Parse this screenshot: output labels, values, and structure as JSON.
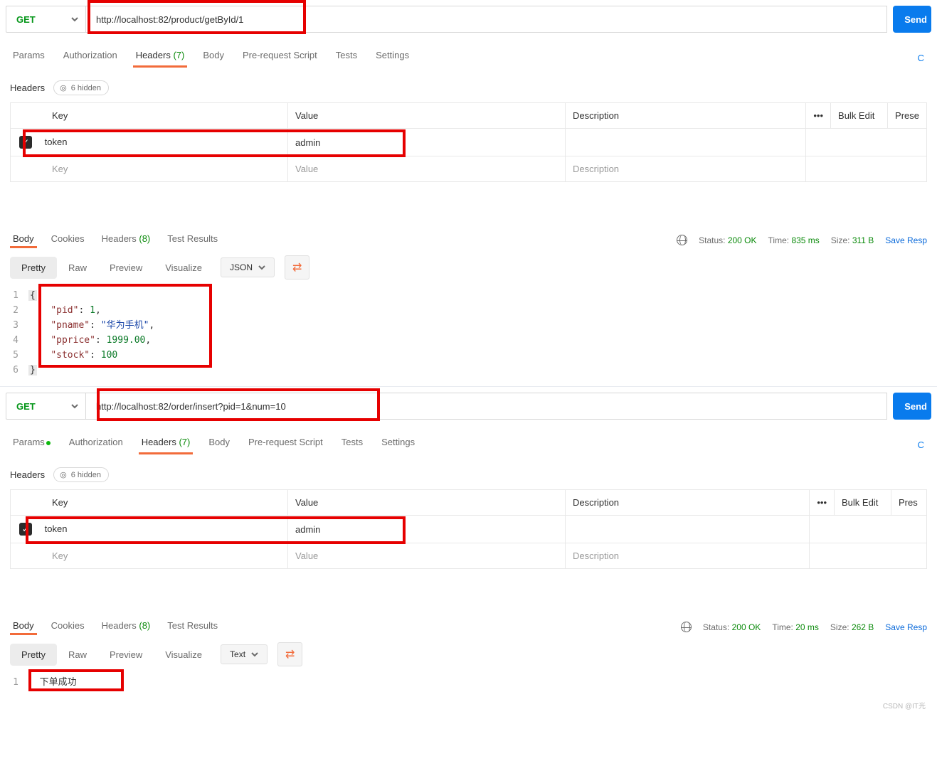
{
  "watermark": "CSDN @IT光",
  "req1": {
    "method": "GET",
    "url": "http://localhost:82/product/getById/1",
    "send": "Send",
    "tabs": {
      "params": "Params",
      "auth": "Authorization",
      "headers": "Headers",
      "headers_count": "(7)",
      "body": "Body",
      "prereq": "Pre-request Script",
      "tests": "Tests",
      "settings": "Settings",
      "cookies": "C"
    },
    "section": {
      "title": "Headers",
      "hidden": "6 hidden"
    },
    "table": {
      "key": "Key",
      "value": "Value",
      "desc": "Description",
      "bulk": "Bulk Edit",
      "presets": "Prese",
      "row1_key": "token",
      "row1_val": "admin",
      "ph_key": "Key",
      "ph_val": "Value",
      "ph_desc": "Description"
    },
    "resp_tabs": {
      "body": "Body",
      "cookies": "Cookies",
      "headers": "Headers",
      "hcount": "(8)",
      "test": "Test Results"
    },
    "status": {
      "status_l": "Status:",
      "status_v": "200 OK",
      "time_l": "Time:",
      "time_v": "835 ms",
      "size_l": "Size:",
      "size_v": "311 B",
      "save": "Save Resp"
    },
    "view": {
      "pretty": "Pretty",
      "raw": "Raw",
      "preview": "Preview",
      "vis": "Visualize",
      "fmt": "JSON"
    },
    "json": {
      "l1": "{",
      "l6": "}",
      "k_pid": "\"pid\"",
      "v_pid": "1",
      "k_pname": "\"pname\"",
      "v_pname": "\"华为手机\"",
      "k_pprice": "\"pprice\"",
      "v_pprice": "1999.00",
      "k_stock": "\"stock\"",
      "v_stock": "100"
    }
  },
  "req2": {
    "method": "GET",
    "url": "http://localhost:82/order/insert?pid=1&num=10",
    "send": "Send",
    "tabs": {
      "params": "Params",
      "auth": "Authorization",
      "headers": "Headers",
      "headers_count": "(7)",
      "body": "Body",
      "prereq": "Pre-request Script",
      "tests": "Tests",
      "settings": "Settings",
      "cookies": "C"
    },
    "section": {
      "title": "Headers",
      "hidden": "6 hidden"
    },
    "table": {
      "key": "Key",
      "value": "Value",
      "desc": "Description",
      "bulk": "Bulk Edit",
      "presets": "Pres",
      "row1_key": "token",
      "row1_val": "admin",
      "ph_key": "Key",
      "ph_val": "Value",
      "ph_desc": "Description"
    },
    "resp_tabs": {
      "body": "Body",
      "cookies": "Cookies",
      "headers": "Headers",
      "hcount": "(8)",
      "test": "Test Results"
    },
    "status": {
      "status_l": "Status:",
      "status_v": "200 OK",
      "time_l": "Time:",
      "time_v": "20 ms",
      "size_l": "Size:",
      "size_v": "262 B",
      "save": "Save Resp"
    },
    "view": {
      "pretty": "Pretty",
      "raw": "Raw",
      "preview": "Preview",
      "vis": "Visualize",
      "fmt": "Text"
    },
    "text": {
      "line1": "下单成功"
    }
  }
}
